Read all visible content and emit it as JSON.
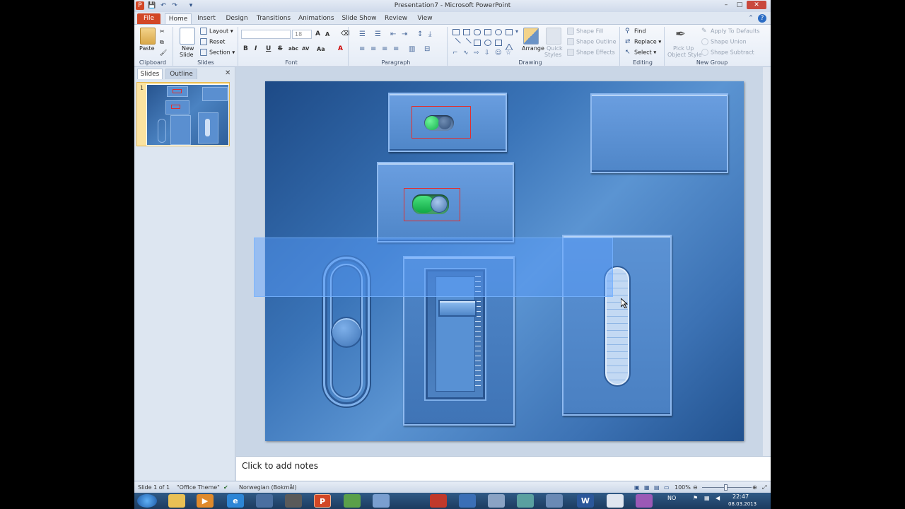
{
  "window": {
    "title": "Presentation7 - Microsoft PowerPoint",
    "minimize": "–",
    "maximize": "□",
    "close": "✕"
  },
  "qat": {
    "save": "💾",
    "undo": "↶",
    "redo": "↷",
    "customize": "▾"
  },
  "tabs": [
    "File",
    "Home",
    "Insert",
    "Design",
    "Transitions",
    "Animations",
    "Slide Show",
    "Review",
    "View"
  ],
  "ribbon": {
    "clipboard": {
      "paste": "Paste",
      "label": "Clipboard"
    },
    "slides": {
      "new_slide_line1": "New",
      "new_slide_line2": "Slide",
      "layout": "Layout",
      "reset": "Reset",
      "section": "Section",
      "label": "Slides"
    },
    "font": {
      "size": "18",
      "grow": "A",
      "shrink": "A",
      "bold": "B",
      "italic": "I",
      "underline": "U",
      "strike": "S",
      "shadow": "abc",
      "spacing": "AV",
      "case": "Aa",
      "color": "A",
      "label": "Font"
    },
    "paragraph": {
      "label": "Paragraph"
    },
    "drawing": {
      "arrange": "Arrange",
      "quick_styles_line1": "Quick",
      "quick_styles_line2": "Styles",
      "shape_fill": "Shape Fill",
      "shape_outline": "Shape Outline",
      "shape_effects": "Shape Effects",
      "label": "Drawing"
    },
    "editing": {
      "find": "Find",
      "replace": "Replace",
      "select": "Select",
      "label": "Editing"
    },
    "new_group": {
      "pickup_line1": "Pick Up",
      "pickup_line2": "Object Style",
      "apply_defaults": "Apply To Defaults",
      "shape_union": "Shape Union",
      "shape_subtract": "Shape Subtract",
      "label": "New Group"
    }
  },
  "left_pane": {
    "tab_slides": "Slides",
    "tab_outline": "Outline",
    "close": "✕",
    "slide_number": "1"
  },
  "notes": {
    "placeholder": "Click to add notes"
  },
  "status": {
    "slide": "Slide 1 of 1",
    "theme": "\"Office Theme\"",
    "language": "Norwegian (Bokmål)",
    "zoom": "100%"
  },
  "taskbar": {
    "language": "NO",
    "time": "22:47",
    "date": "08.03.2013"
  },
  "colors": {
    "accent_file": "#d24726",
    "slide_blue": "#3a74b8",
    "selection": "#5aa0ff",
    "toggle_on": "#1fc25a"
  }
}
